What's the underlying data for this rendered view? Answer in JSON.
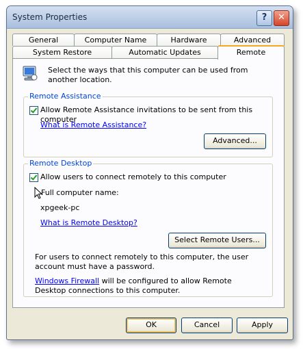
{
  "window": {
    "title": "System Properties"
  },
  "titlebar": {
    "help_label": "?",
    "close_label": "✕"
  },
  "tabs": {
    "row1": [
      "General",
      "Computer Name",
      "Hardware",
      "Advanced"
    ],
    "row2": [
      "System Restore",
      "Automatic Updates",
      "Remote"
    ],
    "active": "Remote"
  },
  "intro": {
    "text": "Select the ways that this computer can be used from another location."
  },
  "remote_assistance": {
    "group_label": "Remote Assistance",
    "checkbox_label": "Allow Remote Assistance invitations to be sent from this computer",
    "checked": true,
    "link": "What is Remote Assistance?",
    "advanced_button": "Advanced..."
  },
  "remote_desktop": {
    "group_label": "Remote Desktop",
    "checkbox_label": "Allow users to connect remotely to this computer",
    "checked": true,
    "computer_name_label": "Full computer name:",
    "computer_name": "xpgeek-pc",
    "link": "What is Remote Desktop?",
    "select_users_button": "Select Remote Users...",
    "note": "For users to connect remotely to this computer, the user account must have a password.",
    "firewall_link": "Windows Firewall",
    "firewall_text": " will be configured to allow Remote Desktop connections to this computer."
  },
  "footer": {
    "ok": "OK",
    "cancel": "Cancel",
    "apply": "Apply"
  }
}
